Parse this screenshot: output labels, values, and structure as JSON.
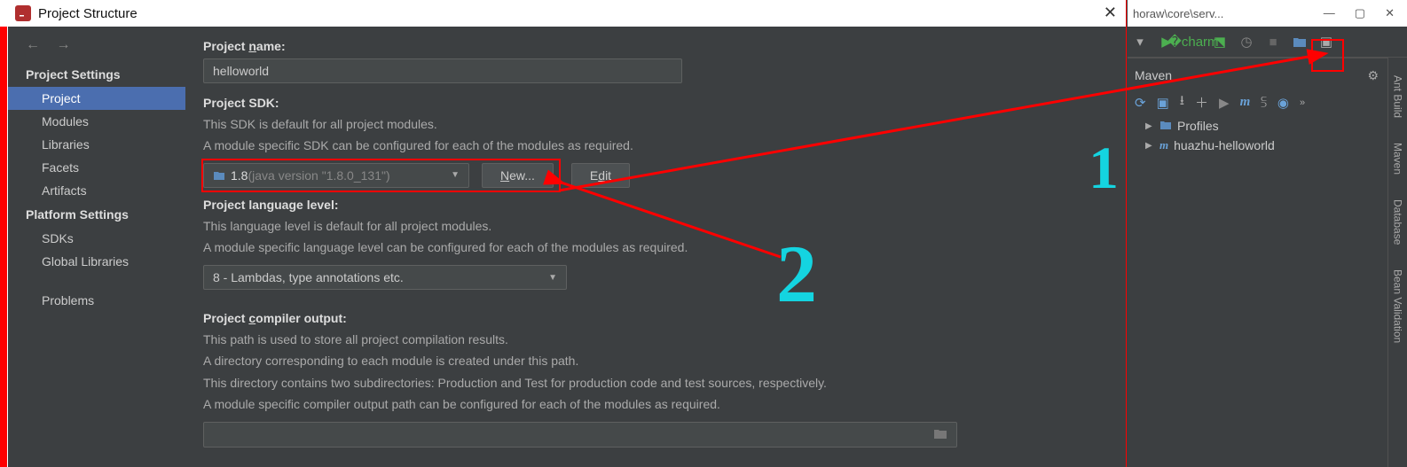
{
  "dialog": {
    "title": "Project Structure",
    "nav": {
      "back": "←",
      "fwd": "→"
    },
    "sections": {
      "project_settings": "Project Settings",
      "platform_settings": "Platform Settings"
    },
    "sidebar": {
      "project": "Project",
      "modules": "Modules",
      "libraries": "Libraries",
      "facets": "Facets",
      "artifacts": "Artifacts",
      "sdks": "SDKs",
      "global_libs": "Global Libraries",
      "problems": "Problems"
    }
  },
  "main": {
    "project_name_label": "Project name:",
    "project_name_value": "helloworld",
    "project_sdk_label": "Project SDK:",
    "sdk_desc1": "This SDK is default for all project modules.",
    "sdk_desc2": "A module specific SDK can be configured for each of the modules as required.",
    "sdk_value_name": "1.8",
    "sdk_value_ver": " (java version \"1.8.0_131\")",
    "new_btn": "New...",
    "edit_btn": "Edit",
    "lang_level_label": "Project language level:",
    "lang_desc1": "This language level is default for all project modules.",
    "lang_desc2": "A module specific language level can be configured for each of the modules as required.",
    "lang_value": "8 - Lambdas, type annotations etc.",
    "output_label": "Project compiler output:",
    "out_desc1": "This path is used to store all project compilation results.",
    "out_desc2": "A directory corresponding to each module is created under this path.",
    "out_desc3": "This directory contains two subdirectories: Production and Test for production code and test sources, respectively.",
    "out_desc4": "A module specific compiler output path can be configured for each of the modules as required."
  },
  "behind": {
    "path_fragment": "horaw\\core\\serv...",
    "maven_title": "Maven",
    "profiles": "Profiles",
    "project": "huazhu-helloworld"
  },
  "gutter": {
    "ant": "Ant Build",
    "maven": "Maven",
    "database": "Database",
    "bean": "Bean Validation"
  },
  "anno": {
    "one": "1",
    "two": "2"
  }
}
